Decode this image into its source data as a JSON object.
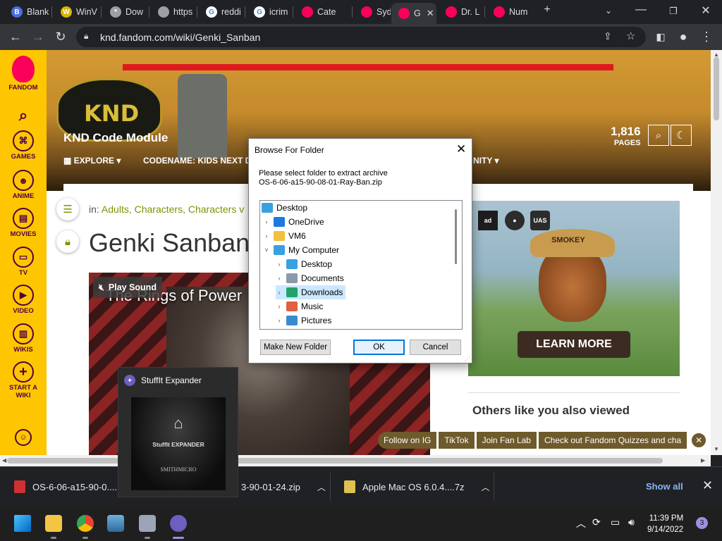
{
  "browser": {
    "tabs": [
      {
        "label": "Blank",
        "fav_color": "#4a6ee0",
        "fav_text": "B"
      },
      {
        "label": "WinV",
        "fav_color": "#d9b500",
        "fav_text": "W"
      },
      {
        "label": "Dow",
        "fav_color": "#9aa0a6",
        "fav_text": "*"
      },
      {
        "label": "https",
        "fav_color": "#9aa0a6",
        "fav_text": ""
      },
      {
        "label": "reddi",
        "fav_color": "#ffffff",
        "fav_text": "G"
      },
      {
        "label": "icrim",
        "fav_color": "#ffffff",
        "fav_text": "G"
      },
      {
        "label": "Cate",
        "fav_color": "#fa005a",
        "fav_text": ""
      },
      {
        "label": "Sydn",
        "fav_color": "#fa005a",
        "fav_text": ""
      },
      {
        "label": "G",
        "fav_color": "#fa005a",
        "fav_text": ""
      },
      {
        "label": "Dr. L",
        "fav_color": "#fa005a",
        "fav_text": ""
      },
      {
        "label": "Num",
        "fav_color": "#fa005a",
        "fav_text": ""
      }
    ],
    "new_tab": "+",
    "url": "knd.fandom.com/wiki/Genki_Sanban"
  },
  "rail": {
    "brand": "FANDOM",
    "items": [
      {
        "label": "GAMES",
        "icon": "gamepad-icon"
      },
      {
        "label": "ANIME",
        "icon": "anime-icon"
      },
      {
        "label": "MOVIES",
        "icon": "movie-icon"
      },
      {
        "label": "TV",
        "icon": "tv-icon"
      },
      {
        "label": "VIDEO",
        "icon": "video-icon"
      },
      {
        "label": "WIKIS",
        "icon": "book-icon"
      },
      {
        "label": "START A WIKI",
        "icon": "plus-icon"
      }
    ]
  },
  "wiki": {
    "title": "KND Code Module",
    "logo_text": "KND",
    "pages_count": "1,816",
    "pages_label": "PAGES",
    "nav": [
      "EXPLORE",
      "CODENAME: KIDS NEXT D",
      "NITY"
    ],
    "categories_prefix": "in:",
    "categories": "Adults, Characters, Characters v",
    "page_title": "Genki Sanban",
    "video_title": "The Rings of Power",
    "play_sound": "Play Sound",
    "ad": {
      "logo1": "ad",
      "logo3": "UAS",
      "hat": "SMOKEY",
      "cta": "LEARN MORE"
    },
    "others": "Others like you also viewed",
    "fanbar": [
      "Follow on IG",
      "TikTok",
      "Join Fan Lab",
      "Check out Fandom Quizzes and cha"
    ]
  },
  "dialog": {
    "title": "Browse For Folder",
    "prompt_line1": "Please select folder to extract archive",
    "prompt_line2": "OS-6-06-a15-90-08-01-Ray-Ban.zip",
    "tree": [
      {
        "label": "Desktop",
        "level": 0,
        "arrow": "",
        "color": "#3aa0e0"
      },
      {
        "label": "OneDrive",
        "level": 1,
        "arrow": "›",
        "color": "#1e7ae0"
      },
      {
        "label": "VM6",
        "level": 1,
        "arrow": "›",
        "color": "#f0c040"
      },
      {
        "label": "My Computer",
        "level": 1,
        "arrow": "˅",
        "color": "#3aa0e0"
      },
      {
        "label": "Desktop",
        "level": 2,
        "arrow": "›",
        "color": "#3aa0e0"
      },
      {
        "label": "Documents",
        "level": 2,
        "arrow": "›",
        "color": "#8a9aa8"
      },
      {
        "label": "Downloads",
        "level": 2,
        "arrow": "›",
        "color": "#22a36b"
      },
      {
        "label": "Music",
        "level": 2,
        "arrow": "›",
        "color": "#e06040"
      },
      {
        "label": "Pictures",
        "level": 2,
        "arrow": "›",
        "color": "#3a8ad0"
      }
    ],
    "selected_index": 6,
    "btn_new_folder": "Make New Folder",
    "btn_ok": "OK",
    "btn_cancel": "Cancel"
  },
  "stuffit": {
    "title": "StuffIt Expander",
    "brand": "StuffIt EXPANDER",
    "maker": "SMITHMICRO"
  },
  "downloads": {
    "items": [
      {
        "label": "OS-6-06-a15-90-0....",
        "color": "#d03030"
      },
      {
        "label": "3-90-01-24.zip",
        "color": "#d03030"
      },
      {
        "label": "Apple Mac OS 6.0.4....7z",
        "color": "#e0c050"
      }
    ],
    "show_all": "Show all"
  },
  "taskbar": {
    "time": "11:39 PM",
    "date": "9/14/2022",
    "notifications": "3"
  }
}
